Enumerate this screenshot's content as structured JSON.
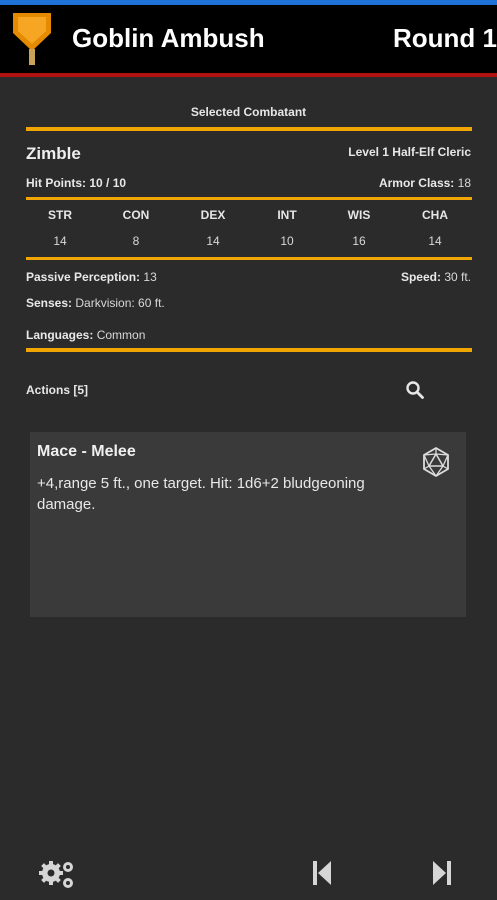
{
  "app_bar": {
    "title": "Goblin Ambush",
    "round": "Round 1",
    "colors": {
      "accent": "#f0a500",
      "rule_red": "#b01212",
      "top_strip": "#1e72d8"
    }
  },
  "panel": {
    "header": "Selected Combatant",
    "name": "Zimble",
    "descriptor": "Level 1 Half-Elf Cleric",
    "hp_label": "Hit Points:",
    "hp_value": "10 / 10",
    "ac_label": "Armor Class:",
    "ac_value": "18",
    "abilities": [
      {
        "abbr": "STR",
        "value": "14"
      },
      {
        "abbr": "CON",
        "value": "8"
      },
      {
        "abbr": "DEX",
        "value": "14"
      },
      {
        "abbr": "INT",
        "value": "10"
      },
      {
        "abbr": "WIS",
        "value": "16"
      },
      {
        "abbr": "CHA",
        "value": "14"
      }
    ],
    "passive_label": "Passive Perception:",
    "passive_value": "13",
    "speed_label": "Speed:",
    "speed_value": "30 ft.",
    "senses_label": "Senses:",
    "senses_value": "Darkvision: 60 ft.",
    "languages_label": "Languages:",
    "languages_value": "Common"
  },
  "actions": {
    "label": "Actions [5]",
    "items": [
      {
        "title": "Mace - Melee",
        "description": "+4,range 5 ft., one target. Hit: 1d6+2 bludgeoning damage."
      }
    ]
  },
  "icons": {
    "logo": "shield-banner-icon",
    "search": "search-icon",
    "dice": "d20-dice-icon",
    "settings": "gears-icon",
    "prev": "skip-previous-icon",
    "next": "skip-next-icon"
  }
}
